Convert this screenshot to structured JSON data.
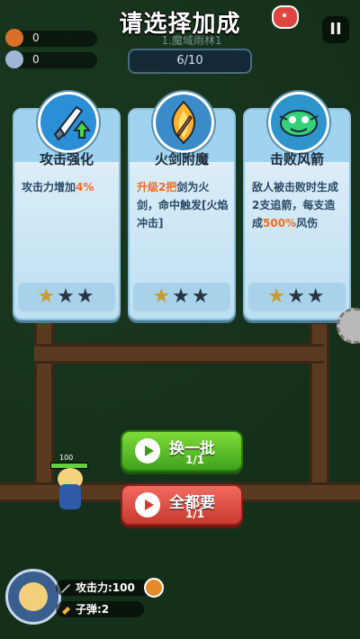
{
  "screen_title": "请选择加成",
  "hud": {
    "gold": "0",
    "gems": "0",
    "wave_title": "1.魔域雨林1",
    "progress": "6/10",
    "pause": "II"
  },
  "cards": [
    {
      "name": "攻击强化",
      "icon": "sword-upgrade-icon",
      "desc_parts": [
        "攻击力增加",
        "4%",
        ""
      ],
      "stars_filled": 1,
      "stars_total": 3
    },
    {
      "name": "火剑附魔",
      "icon": "fire-sword-icon",
      "desc_parts": [
        "升级2把",
        "剑为火剑，命中触发[火焰冲击]"
      ],
      "stars_filled": 1,
      "stars_total": 3
    },
    {
      "name": "击败风箭",
      "icon": "wind-arrow-icon",
      "desc_parts": [
        "敌人被击败时生成2支追箭，每支造成",
        "500%",
        "风伤"
      ],
      "stars_filled": 1,
      "stars_total": 3
    }
  ],
  "buttons": {
    "refresh": {
      "label": "换一批",
      "count": "1/1",
      "color": "#4cb82a"
    },
    "take_all": {
      "label": "全都要",
      "count": "1/1",
      "color": "#d9473d"
    }
  },
  "hero": {
    "hp_text": "100"
  },
  "player": {
    "attack_label": "攻击力:100",
    "bullets_label": "子弹:2"
  },
  "colors": {
    "highlight": "#f26b23",
    "star_filled": "#c99a2b",
    "star_empty": "#2a3442"
  }
}
